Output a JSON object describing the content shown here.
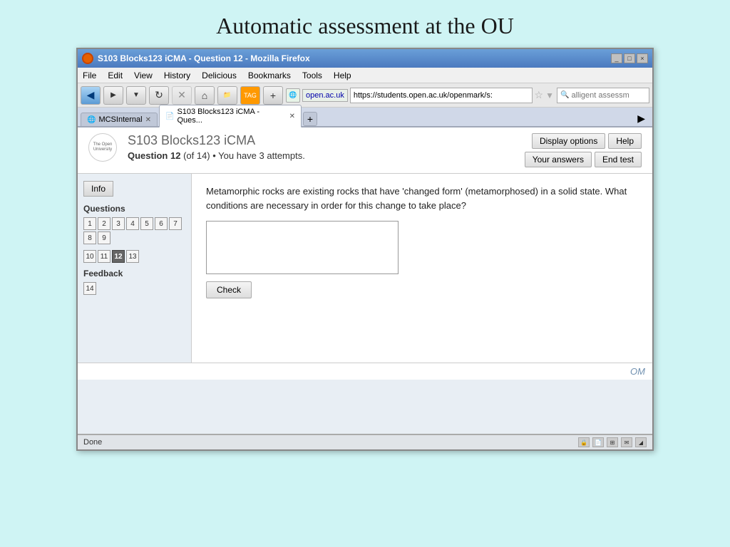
{
  "page": {
    "title": "Automatic assessment at the OU"
  },
  "browser": {
    "title": "S103 Blocks123 iCMA - Question 12 - Mozilla Firefox",
    "minimize_label": "_",
    "maximize_label": "□",
    "close_label": "×",
    "address": "https://students.open.ac.uk/openmark/s:",
    "address_short": "open.ac.uk",
    "search_placeholder": "alligent assessm",
    "status_text": "Done"
  },
  "menu": {
    "items": [
      "File",
      "Edit",
      "View",
      "History",
      "Delicious",
      "Bookmarks",
      "Tools",
      "Help"
    ]
  },
  "tabs": [
    {
      "label": "MCSInternal",
      "active": false
    },
    {
      "label": "S103 Blocks123 iCMA - Ques...",
      "active": true
    }
  ],
  "openmark": {
    "title": "S103 Blocks123 iCMA",
    "question_label": "Question",
    "question_number": "12",
    "question_info": "(of 14) • You have 3 attempts.",
    "display_options_btn": "Display options",
    "help_btn": "Help",
    "your_answers_btn": "Your answers",
    "end_test_btn": "End test",
    "info_btn": "Info",
    "questions_section": "Questions",
    "question_numbers_row1": [
      "1",
      "2",
      "3",
      "4",
      "5",
      "6",
      "7",
      "8",
      "9"
    ],
    "question_numbers_row2": [
      "10",
      "11",
      "12",
      "13"
    ],
    "feedback_section": "Feedback",
    "feedback_numbers": [
      "14"
    ],
    "active_question": "12",
    "question_text": "Metamorphic rocks are existing rocks that have 'changed form' (metamorphosed) in a solid state. What conditions are necessary in order for this change to take place?",
    "check_btn": "Check",
    "watermark": "OM"
  }
}
